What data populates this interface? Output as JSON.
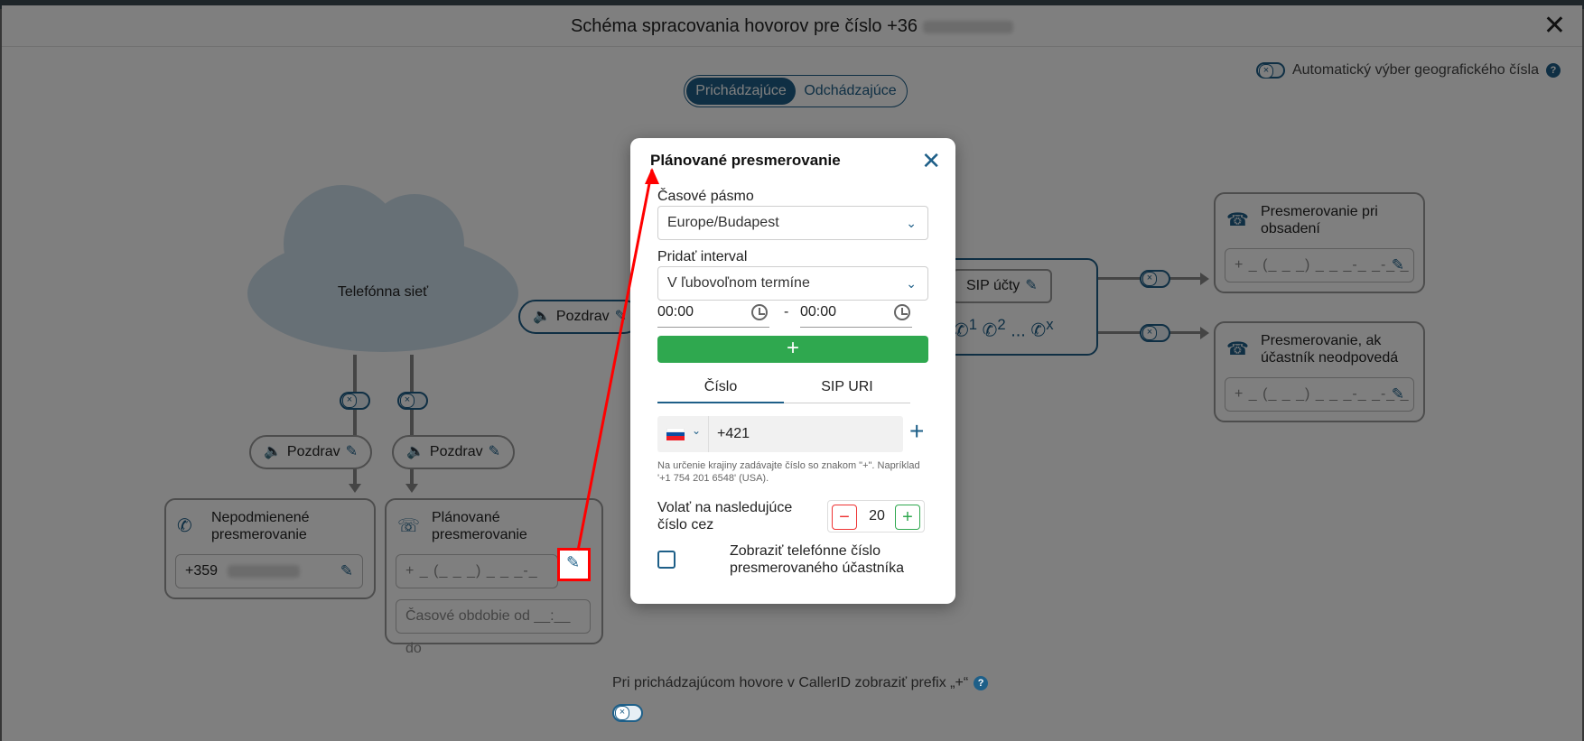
{
  "window": {
    "title": "Schéma spracovania hovorov pre číslo +36",
    "close": "✕"
  },
  "direction_tabs": {
    "incoming": "Prichádzajúce",
    "outgoing": "Odchádzajúce",
    "selected": "incoming"
  },
  "auto_geo": {
    "label": "Automatický výber geografického čísla",
    "help": "?"
  },
  "cloud": {
    "label": "Telefónna sieť"
  },
  "greeting": {
    "label": "Pozdrav"
  },
  "sip": {
    "label": "SIP účty",
    "extensions": [
      "1",
      "2",
      "...",
      "x"
    ]
  },
  "cards": {
    "unconditional": {
      "title": "Nepodmienené presmerovanie",
      "value": "+359"
    },
    "scheduled": {
      "title": "Plánované presmerovanie",
      "placeholder": "+ _ (_ _ _) _ _ _-_ _-_ _",
      "period_placeholder": "Časové obdobie od __:__ do"
    },
    "busy": {
      "title": "Presmerovanie pri obsadení",
      "placeholder": "+ _ (_ _ _) _ _ _-_ _-_ _"
    },
    "noanswer": {
      "title": "Presmerovanie, ak účastník neodpovedá",
      "placeholder": "+ _ (_ _ _) _ _ _-_ _-_ _"
    }
  },
  "bottom": {
    "label": "Pri prichádzajúcom hovore v CallerID zobraziť prefix „+“",
    "help": "?"
  },
  "modal": {
    "title": "Plánované presmerovanie",
    "timezone_label": "Časové pásmo",
    "timezone_value": "Europe/Budapest",
    "interval_label": "Pridať interval",
    "interval_value": "V ľubovoľnom termíne",
    "time_from": "00:00",
    "time_sep": "-",
    "time_to": "00:00",
    "add": "+",
    "tabs": [
      "Číslo",
      "SIP URI"
    ],
    "phone_prefix": "+421",
    "add_number": "+",
    "hint": "Na určenie krajiny zadávajte číslo so znakom \"+\". Napríklad '+1 754 201 6548' (USA).",
    "call_label": "Volať na nasledujúce číslo cez",
    "call_seconds": "20",
    "minus": "−",
    "plus": "+",
    "show_number_label": "Zobraziť telefónne číslo presmerovaného účastníka"
  },
  "colors": {
    "accent": "#1e5f88",
    "green": "#2fa84f",
    "annotation": "#ff0000"
  }
}
